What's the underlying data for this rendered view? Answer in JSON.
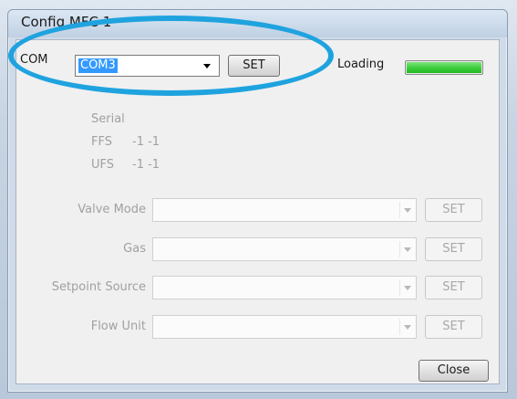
{
  "window": {
    "title": "Config MFC 1"
  },
  "com": {
    "label": "COM",
    "value": "COM3",
    "set_label": "SET"
  },
  "loading": {
    "label": "Loading",
    "progress": 1.0
  },
  "info": {
    "serial_label": "Serial",
    "ffs_label": "FFS",
    "ffs_value": "-1 -1",
    "ufs_label": "UFS",
    "ufs_value": "-1 -1"
  },
  "rows": [
    {
      "label": "Valve Mode",
      "value": "",
      "set_label": "SET"
    },
    {
      "label": "Gas",
      "value": "",
      "set_label": "SET"
    },
    {
      "label": "Setpoint Source",
      "value": "",
      "set_label": "SET"
    },
    {
      "label": "Flow Unit",
      "value": "",
      "set_label": "SET"
    }
  ],
  "close_label": "Close",
  "colors": {
    "highlight": "#1fa3df",
    "selection": "#3399ff",
    "progress": "#3fcf3f"
  }
}
